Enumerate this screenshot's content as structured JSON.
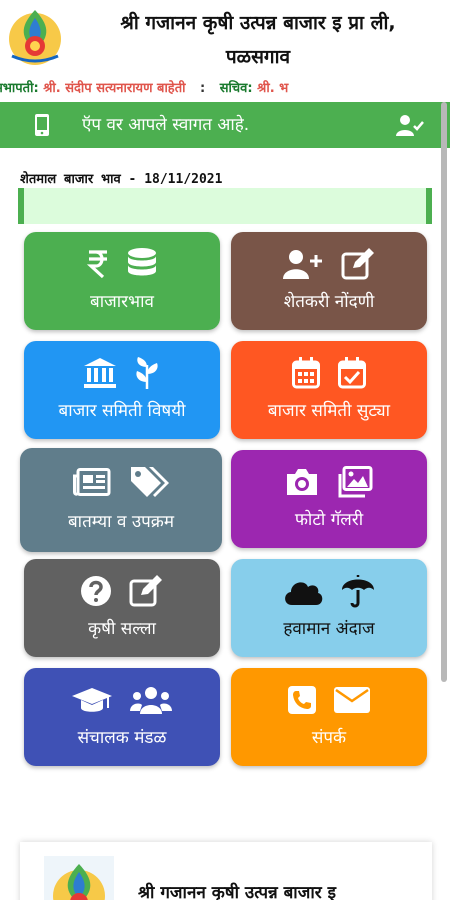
{
  "header": {
    "title": "श्री गजानन कृषी उत्पन्न बाजार इ प्रा ली,",
    "subtitle": "पळसगाव",
    "chairman_label": "सभापती:",
    "chairman_name": "श्री. संदीप सत्यनारायण बाहेती",
    "separator": ":",
    "secretary_label": "सचिव:",
    "secretary_name": "श्री. भ"
  },
  "welcome": {
    "text": "ऍप वर आपले स्वागत आहे.",
    "phone_icon": "mobile-phone-icon",
    "user_icon": "user-check-icon"
  },
  "rates": {
    "title": "शेतमाल बाजार भाव - 18/11/2021"
  },
  "tiles": [
    {
      "label": "बाजारभाव",
      "color": "#4caf50",
      "icons": [
        "rupee-icon",
        "database-icon"
      ]
    },
    {
      "label": "शेतकरी नोंदणी",
      "color": "#795548",
      "icons": [
        "user-plus-icon",
        "edit-icon"
      ]
    },
    {
      "label": "बाजार समिती विषयी",
      "color": "#2196f3",
      "icons": [
        "bank-icon",
        "leaf-icon"
      ]
    },
    {
      "label": "बाजार समिती सुट्या",
      "color": "#ff5722",
      "icons": [
        "calendar-icon",
        "calendar-check-icon"
      ]
    },
    {
      "label": "बातम्या व उपक्रम",
      "color": "#607d8b",
      "icons": [
        "newspaper-icon",
        "tags-icon"
      ]
    },
    {
      "label": "फोटो गॅलरी",
      "color": "#9c27b0",
      "icons": [
        "camera-icon",
        "images-icon"
      ]
    },
    {
      "label": "कृषी सल्ला",
      "color": "#616161",
      "icons": [
        "question-circle-icon",
        "edit-icon"
      ]
    },
    {
      "label": "हवामान अंदाज",
      "color": "#87ceeb",
      "icons": [
        "cloud-icon",
        "umbrella-icon"
      ]
    },
    {
      "label": "संचालक मंडळ",
      "color": "#3f51b5",
      "icons": [
        "graduation-cap-icon",
        "users-icon"
      ]
    },
    {
      "label": "संपर्क",
      "color": "#ff9800",
      "icons": [
        "phone-icon",
        "envelope-icon"
      ]
    }
  ],
  "footer": {
    "title": "श्री गजानन कृषी उत्पन्न बाजार इ"
  }
}
